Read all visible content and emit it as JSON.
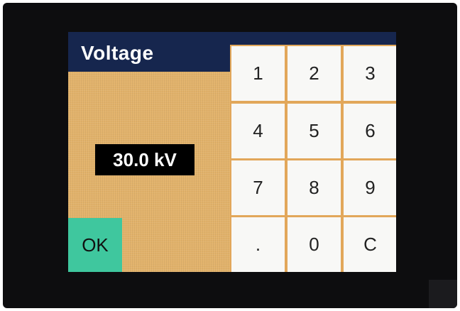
{
  "dialog": {
    "title": "Voltage",
    "value": "30.0 kV",
    "ok_label": "OK"
  },
  "keypad": {
    "keys": [
      "1",
      "2",
      "3",
      "4",
      "5",
      "6",
      "7",
      "8",
      "9",
      ".",
      "0",
      "C"
    ]
  },
  "colors": {
    "title_bar": "#16264e",
    "background": "#e2b26a",
    "ok_button": "#3fc79e",
    "key": "#f8f8f6",
    "value_box": "#000000"
  }
}
